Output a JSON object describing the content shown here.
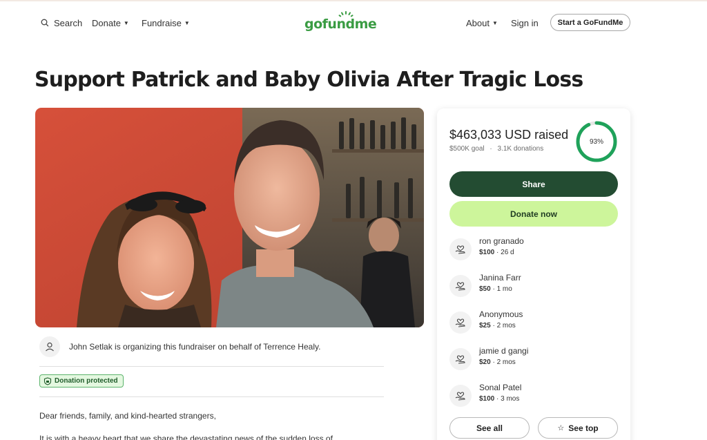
{
  "header": {
    "search_label": "Search",
    "donate_label": "Donate",
    "fundraise_label": "Fundraise",
    "logo_text": "gofundme",
    "about_label": "About",
    "signin_label": "Sign in",
    "start_label": "Start a GoFundMe"
  },
  "campaign": {
    "title": "Support Patrick and Baby Olivia After Tragic Loss",
    "organizer_text": "John Setlak is organizing this fundraiser on behalf of Terrence Healy.",
    "badge_label": "Donation protected",
    "story_line_1": "Dear friends, family, and kind-hearted strangers,",
    "story_line_2": "It is with a heavy heart that we share the devastating news of the sudden loss of"
  },
  "donation_card": {
    "raised_amount": "$463,033",
    "raised_suffix": " USD raised",
    "goal_text": "$500K goal",
    "donations_text": "3.1K donations",
    "separator": "·",
    "progress_percent_label": "93%",
    "progress_fraction": 0.93,
    "share_label": "Share",
    "donate_label": "Donate now",
    "donors": [
      {
        "name": "ron granado",
        "amount": "$100",
        "time": "26 d"
      },
      {
        "name": "Janina Farr",
        "amount": "$50",
        "time": "1 mo"
      },
      {
        "name": "Anonymous",
        "amount": "$25",
        "time": "2 mos"
      },
      {
        "name": "jamie d gangi",
        "amount": "$20",
        "time": "2 mos"
      },
      {
        "name": "Sonal Patel",
        "amount": "$100",
        "time": "3 mos"
      }
    ],
    "see_all_label": "See all",
    "see_top_label": "See top"
  },
  "colors": {
    "brand_green": "#3a9c43",
    "share_button": "#234c32",
    "donate_button": "#cdf59b",
    "progress_ring": "#1fa25a"
  }
}
